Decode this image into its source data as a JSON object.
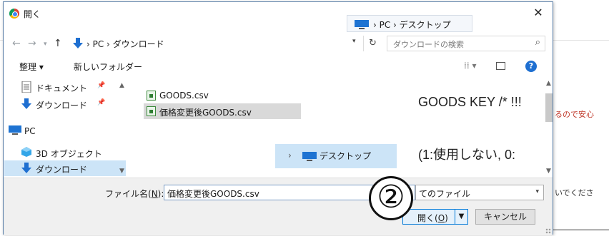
{
  "background": {
    "snippet_1": "るので安心",
    "snippet_2": "いでくださ"
  },
  "dialog": {
    "title": "開く",
    "close_label": "✕"
  },
  "drag_tooltip": {
    "text": "› PC › デスクトップ"
  },
  "address_bar": {
    "back": "←",
    "forward": "→",
    "up": "↑",
    "breadcrumb": "› PC › ダウンロード",
    "refresh": "↻",
    "search_placeholder": "ダウンロードの検索",
    "search_icon": "⌕"
  },
  "toolbar": {
    "organize_label": "整理 ▾",
    "new_folder_label": "新しいフォルダー",
    "view_label": "⁞⁞ ▾",
    "help_label": "?"
  },
  "nav_pane": {
    "items": [
      {
        "label": "ドキュメント",
        "icon": "document-icon",
        "pinned": true
      },
      {
        "label": "ダウンロード",
        "icon": "download-icon",
        "pinned": true
      },
      {
        "label": "PC",
        "icon": "pc-icon",
        "pinned": false
      },
      {
        "label": "3D オブジェクト",
        "icon": "3d-objects-icon",
        "pinned": false
      },
      {
        "label": "ダウンロード",
        "icon": "download-icon",
        "pinned": false,
        "selected": true
      }
    ]
  },
  "files": [
    {
      "name": "GOODS.csv",
      "icon": "csv-file-icon",
      "selected": false
    },
    {
      "name": "価格変更後GOODS.csv",
      "icon": "csv-file-icon",
      "selected": true
    }
  ],
  "drop_target": {
    "label": "デスクトップ"
  },
  "preview": {
    "line_1": "GOODS KEY /* !!!",
    "line_2": "(1:使用しない, 0:"
  },
  "bottom": {
    "filename_label": "ファイル名(",
    "filename_key": "N",
    "filename_label_end": "):",
    "filename_value": "価格変更後GOODS.csv",
    "filetype_value": "てのファイル",
    "open_label": "開く(",
    "open_key": "O",
    "open_label_end": ")",
    "cancel_label": "キャンセル"
  },
  "annotation": {
    "circle_number": "②"
  },
  "colors": {
    "accent": "#0078d7",
    "selection": "#cce4f7",
    "help_icon": "#1e6fd1",
    "download_arrow": "#1e6fd1"
  }
}
